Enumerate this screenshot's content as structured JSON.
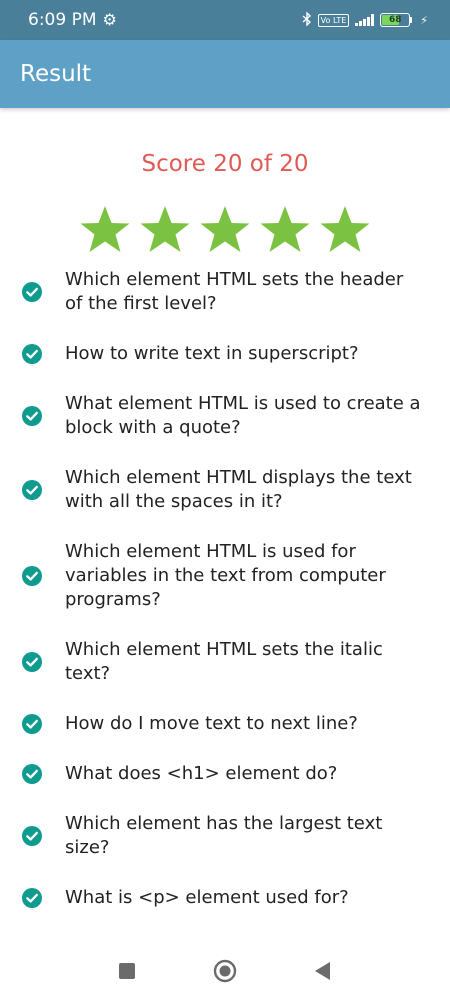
{
  "status_bar": {
    "time": "6:09 PM",
    "icons": [
      "gear-icon",
      "bluetooth-icon",
      "volte-badge",
      "signal-icon",
      "battery-icon",
      "charging-icon"
    ],
    "volte_label": "Vo LTE",
    "battery_level": "68",
    "battery_percent": 68
  },
  "app_bar": {
    "title": "Result"
  },
  "result": {
    "score_text": "Score 20 of 20",
    "stars_filled": 5,
    "stars_total": 5,
    "star_color": "#7cc242"
  },
  "questions": [
    {
      "text": "Which element HTML sets the header of the first level?",
      "correct": true
    },
    {
      "text": "How to write text in superscript?",
      "correct": true
    },
    {
      "text": "What element HTML is used to create a block with a quote?",
      "correct": true
    },
    {
      "text": "Which element HTML displays the text with all the spaces in it?",
      "correct": true
    },
    {
      "text": "Which element HTML is used for variables in the text from computer programs?",
      "correct": true
    },
    {
      "text": "Which element HTML sets the italic text?",
      "correct": true
    },
    {
      "text": "How do I move text to next line?",
      "correct": true
    },
    {
      "text": "What does <h1> element do?",
      "correct": true
    },
    {
      "text": "Which element has the largest text size?",
      "correct": true
    },
    {
      "text": "What is <p> element used for?",
      "correct": true
    }
  ],
  "colors": {
    "status_bar_bg": "#4a7f9a",
    "app_bar_bg": "#5fa0c6",
    "score_color": "#e05a55",
    "check_color": "#0f9b8e"
  },
  "nav_bar": {
    "buttons": [
      "recents-square-icon",
      "home-circle-icon",
      "back-triangle-icon"
    ]
  }
}
